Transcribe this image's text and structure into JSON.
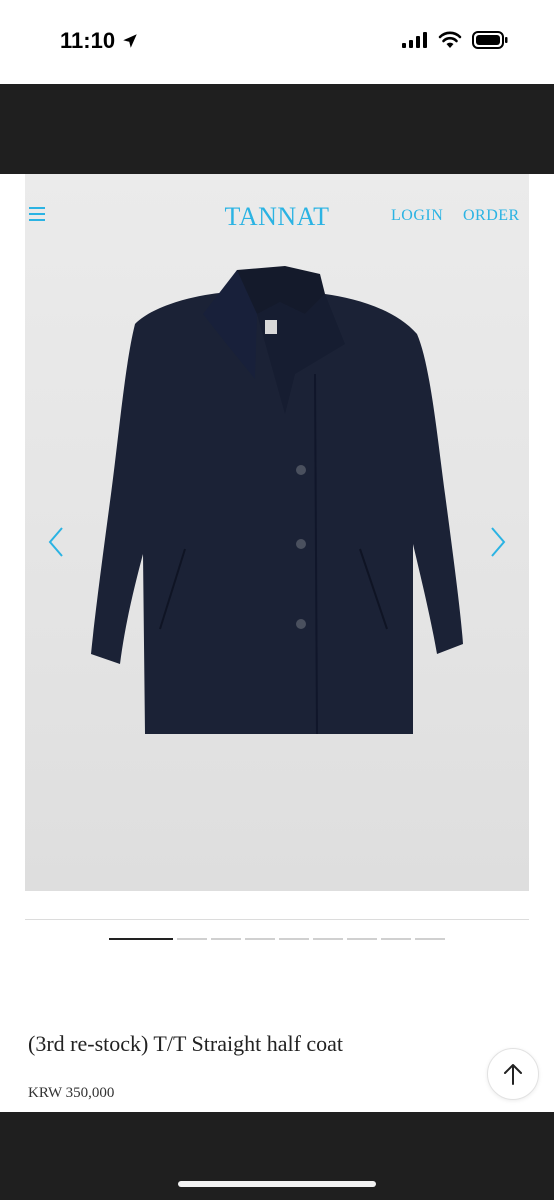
{
  "status_bar": {
    "time": "11:10"
  },
  "header": {
    "brand": "TANNAT",
    "login": "LOGIN",
    "order": "ORDER"
  },
  "colors": {
    "accent": "#2bb3e3",
    "coat": "#1a2238",
    "band": "#1f1f1f"
  },
  "carousel": {
    "slide_count": 10,
    "active_index": 0
  },
  "product": {
    "title": "(3rd re-stock) T/T Straight half coat",
    "price": "KRW 350,000"
  },
  "icons": [
    "location-arrow-icon",
    "signal-icon",
    "wifi-icon",
    "battery-icon",
    "menu-icon",
    "chevron-left-icon",
    "chevron-right-icon",
    "arrow-up-icon"
  ]
}
